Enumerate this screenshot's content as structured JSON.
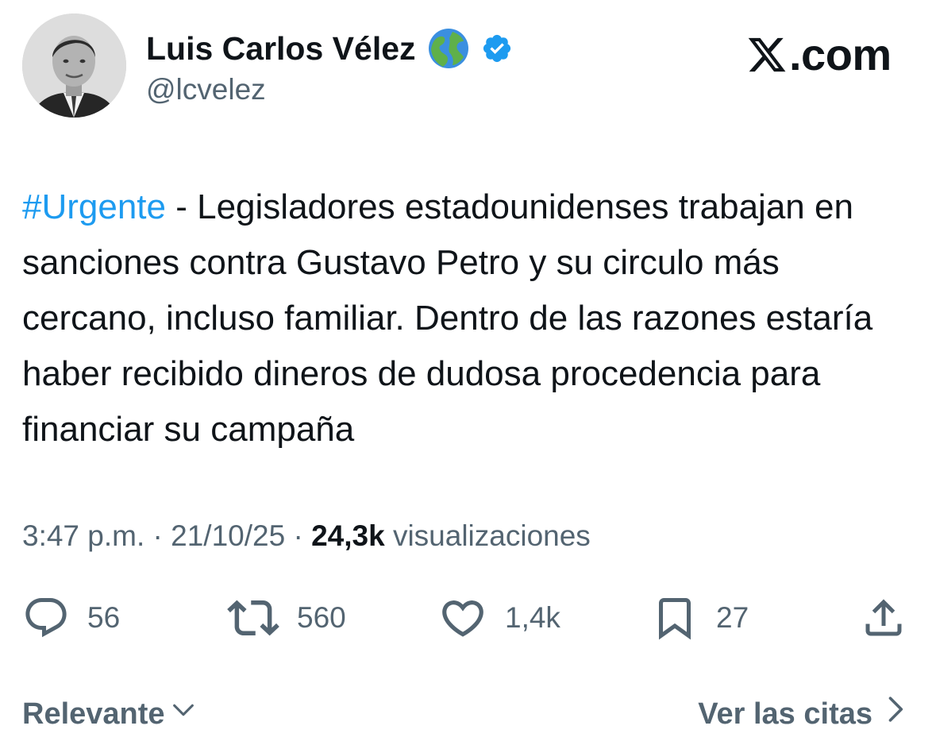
{
  "author": {
    "name": "Luis Carlos Vélez",
    "handle": "@lcvelez",
    "name_emoji": "globe-americas-emoji",
    "verified_icon": "verified-badge-icon",
    "verified_color": "#1d9bf0"
  },
  "brand": {
    "logo_icon": "x-logo-icon",
    "suffix": ".com"
  },
  "tweet": {
    "hashtag": "#Urgente",
    "body": " - Legisladores estadounidenses trabajan en sanciones contra Gustavo Petro y su circulo más cercano, incluso familiar. Dentro de las razones estaría haber recibido dineros de dudosa procedencia para financiar su campaña",
    "hashtag_color": "#1d9bf0"
  },
  "meta": {
    "time": "3:47 p.m.",
    "separator": " · ",
    "date": "21/10/25",
    "views_count": "24,3k",
    "views_label": " visualizaciones"
  },
  "actions": {
    "replies": "56",
    "reposts": "560",
    "likes": "1,4k",
    "bookmarks": "27"
  },
  "footer": {
    "sort_label": "Relevante",
    "quotes_label": "Ver las citas"
  },
  "colors": {
    "text_primary": "#0f1419",
    "text_secondary": "#536471",
    "accent": "#1d9bf0"
  }
}
